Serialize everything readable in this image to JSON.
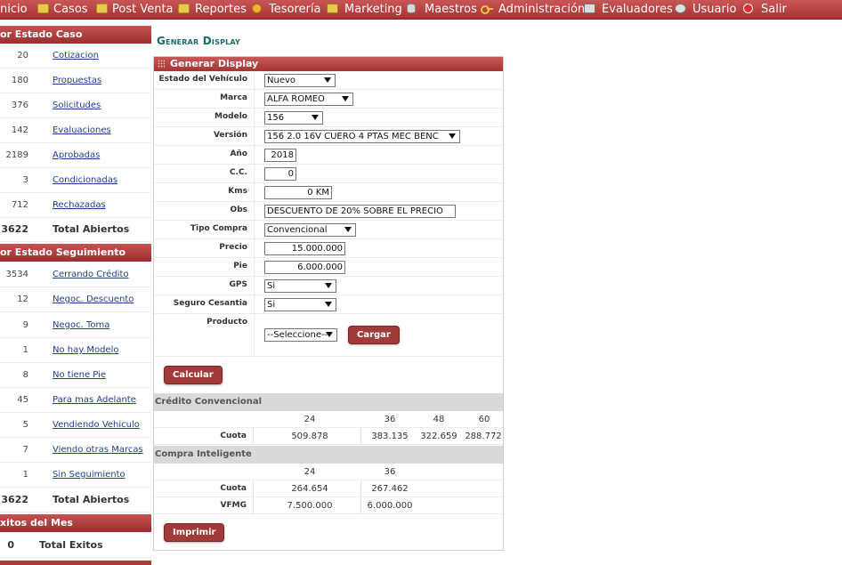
{
  "topnav": {
    "items": [
      {
        "label": "nicio",
        "icon": "none"
      },
      {
        "label": "Casos",
        "icon": "folder-icon"
      },
      {
        "label": "Post Venta",
        "icon": "folder-icon"
      },
      {
        "label": "Reportes",
        "icon": "folder-icon"
      },
      {
        "label": "Tesorería",
        "icon": "coin-icon"
      },
      {
        "label": "Marketing",
        "icon": "mail-icon"
      },
      {
        "label": "Maestros",
        "icon": "database-icon"
      },
      {
        "label": "Administración",
        "icon": "key-icon"
      },
      {
        "label": "Evaluadores",
        "icon": "evaluators-icon"
      },
      {
        "label": "Usuario",
        "icon": "user-icon"
      },
      {
        "label": "Salir",
        "icon": "exit-icon"
      }
    ]
  },
  "sidebar": {
    "estado_caso": {
      "header": "or Estado Caso",
      "items": [
        {
          "count": "20",
          "label": "Cotizacion"
        },
        {
          "count": "180",
          "label": "Propuestas"
        },
        {
          "count": "376",
          "label": "Solicitudes"
        },
        {
          "count": "142",
          "label": "Evaluaciones"
        },
        {
          "count": "2189",
          "label": "Aprobadas"
        },
        {
          "count": "3",
          "label": "Condicionadas"
        },
        {
          "count": "712",
          "label": "Rechazadas"
        }
      ],
      "total": {
        "count": "3622",
        "label": "Total Abiertos"
      }
    },
    "estado_seguimiento": {
      "header": "or Estado Seguimiento",
      "items": [
        {
          "count": "3534",
          "label": "Cerrando Crédito"
        },
        {
          "count": "12",
          "label": "Negoc. Descuento"
        },
        {
          "count": "9",
          "label": "Negoc. Toma"
        },
        {
          "count": "1",
          "label": "No hay Modelo"
        },
        {
          "count": "8",
          "label": "No tiene Pie"
        },
        {
          "count": "45",
          "label": "Para mas Adelante"
        },
        {
          "count": "5",
          "label": "Vendiendo Vehiculo"
        },
        {
          "count": "7",
          "label": "Viendo otras Marcas"
        },
        {
          "count": "1",
          "label": "Sin Seguimiento"
        }
      ],
      "total": {
        "count": "3622",
        "label": "Total Abiertos"
      }
    },
    "exitos": {
      "header": "xitos del Mes",
      "total": {
        "count": "0",
        "label": "Total Exitos"
      }
    }
  },
  "page": {
    "title": "Generar Display",
    "panel_title": "Generar Display"
  },
  "form": {
    "estado": {
      "label": "Estado del Vehículo",
      "value": "Nuevo"
    },
    "marca": {
      "label": "Marca",
      "value": "ALFA ROMEO"
    },
    "modelo": {
      "label": "Modelo",
      "value": "156"
    },
    "version": {
      "label": "Versión",
      "value": "156 2.0 16V CUERO 4 PTAS MEC BENC"
    },
    "anio": {
      "label": "Año",
      "value": "2018"
    },
    "cc": {
      "label": "C.C.",
      "value": "0"
    },
    "kms": {
      "label": "Kms",
      "value": "0 KM"
    },
    "obs": {
      "label": "Obs",
      "value": "DESCUENTO DE 20% SOBRE EL PRECIO"
    },
    "tipo_compra": {
      "label": "Tipo Compra",
      "value": "Convencional"
    },
    "precio": {
      "label": "Precio",
      "value": "15.000.000"
    },
    "pie": {
      "label": "Pie",
      "value": "6.000.000"
    },
    "gps": {
      "label": "GPS",
      "value": "Si"
    },
    "seguro": {
      "label": "Seguro Cesantia",
      "value": "Si"
    },
    "producto": {
      "label": "Producto",
      "value": "--Seleccione--"
    },
    "cargar_label": "Cargar",
    "calcular_label": "Calcular",
    "imprimir_label": "Imprimir"
  },
  "credito_convencional": {
    "header": "Crédito Convencional",
    "plazos": [
      "24",
      "36",
      "48",
      "60"
    ],
    "cuota_label": "Cuota",
    "cuotas": [
      "509.878",
      "383.135",
      "322.659",
      "288.772"
    ]
  },
  "compra_inteligente": {
    "header": "Compra Inteligente",
    "plazos": [
      "24",
      "36"
    ],
    "cuota_label": "Cuota",
    "cuotas": [
      "264.654",
      "267.462"
    ],
    "vfmg_label": "VFMG",
    "vfmg": [
      "7.500.000",
      "6.000.000"
    ]
  },
  "colors": {
    "accent": "#a83232",
    "title": "#1b6a6a",
    "link": "#1f3f8a"
  }
}
